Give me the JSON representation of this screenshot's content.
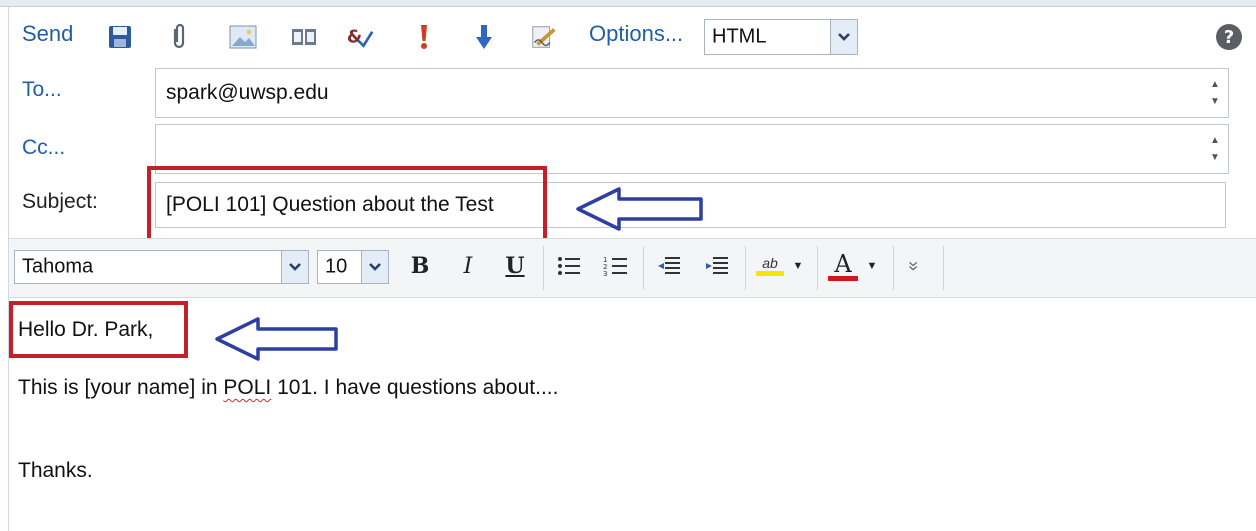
{
  "toolbar": {
    "send_label": "Send",
    "options_label": "Options...",
    "format_select": {
      "selected": "HTML"
    },
    "icons": [
      "save-icon",
      "attach-icon",
      "insert-image-icon",
      "address-book-icon",
      "check-names-icon",
      "importance-high-icon",
      "importance-low-icon",
      "signature-icon",
      "help-icon"
    ]
  },
  "fields": {
    "to": {
      "label": "To...",
      "value": "spark@uwsp.edu"
    },
    "cc": {
      "label": "Cc...",
      "value": ""
    },
    "subject": {
      "label": "Subject:",
      "value": "[POLI 101] Question about the Test"
    }
  },
  "format_bar": {
    "font": "Tahoma",
    "size": "10",
    "bold": "B",
    "italic": "I",
    "underline": "U",
    "highlight_glyph": "ab",
    "font_color_glyph": "A",
    "more_glyph": "»"
  },
  "message": {
    "greeting": "Hello Dr. Park,",
    "line1_pre": "This is [your name] in ",
    "line1_misspelled": "POLI",
    "line1_post": " 101. I have questions about....",
    "closing": "Thanks."
  },
  "colors": {
    "link_blue": "#1f5fa8",
    "annotation_red": "#c4202a",
    "annotation_arrow_blue": "#2d3fa3"
  }
}
